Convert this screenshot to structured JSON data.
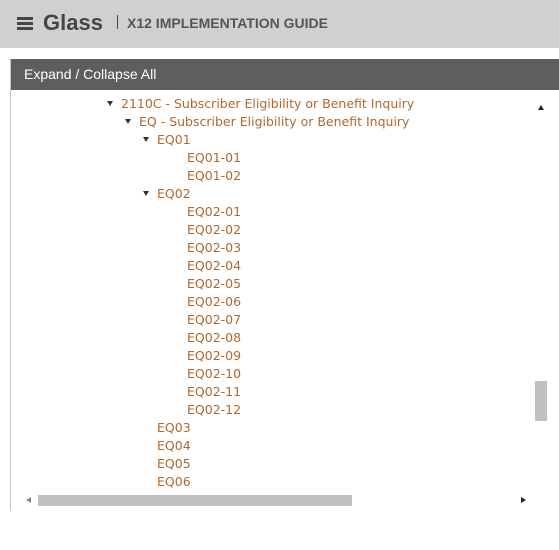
{
  "header": {
    "brand": "Glass",
    "subtitle": "X12 IMPLEMENTATION GUIDE",
    "menu_icon": "hamburger-menu-icon"
  },
  "panel": {
    "toggle_all_label": "Expand / Collapse All"
  },
  "tree": [
    {
      "label": "2110C - Subscriber Eligibility or Benefit Inquiry",
      "level": 0,
      "expanded": true
    },
    {
      "label": "EQ - Subscriber Eligibility or Benefit Inquiry",
      "level": 1,
      "expanded": true
    },
    {
      "label": "EQ01",
      "level": 2,
      "expanded": true
    },
    {
      "label": "EQ01-01",
      "level": 3
    },
    {
      "label": "EQ01-02",
      "level": 3
    },
    {
      "label": "EQ02",
      "level": 2,
      "expanded": true
    },
    {
      "label": "EQ02-01",
      "level": 3
    },
    {
      "label": "EQ02-02",
      "level": 3
    },
    {
      "label": "EQ02-03",
      "level": 3
    },
    {
      "label": "EQ02-04",
      "level": 3
    },
    {
      "label": "EQ02-05",
      "level": 3
    },
    {
      "label": "EQ02-06",
      "level": 3
    },
    {
      "label": "EQ02-07",
      "level": 3
    },
    {
      "label": "EQ02-08",
      "level": 3
    },
    {
      "label": "EQ02-09",
      "level": 3
    },
    {
      "label": "EQ02-10",
      "level": 3
    },
    {
      "label": "EQ02-11",
      "level": 3
    },
    {
      "label": "EQ02-12",
      "level": 3
    },
    {
      "label": "EQ03",
      "level": 2
    },
    {
      "label": "EQ04",
      "level": 2
    },
    {
      "label": "EQ05",
      "level": 2
    },
    {
      "label": "EQ06",
      "level": 2
    }
  ],
  "colors": {
    "link": "#b2682d",
    "header_bg": "#d0d0d0",
    "panel_header_bg": "#5e5e5e"
  }
}
